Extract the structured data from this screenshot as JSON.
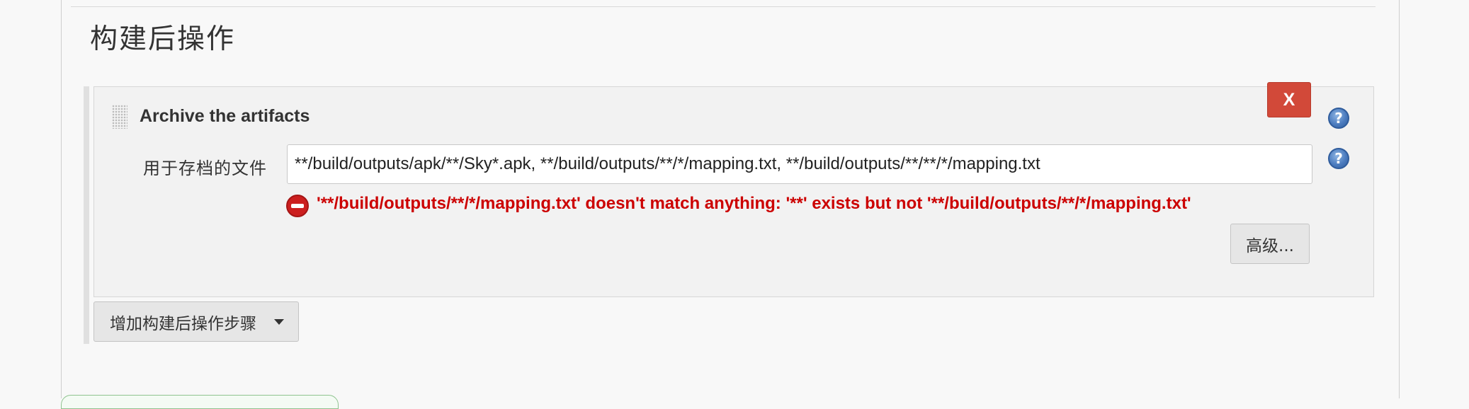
{
  "section": {
    "title": "构建后操作"
  },
  "step": {
    "title": "Archive the artifacts",
    "delete_label": "X",
    "help_glyph": "?",
    "field_label": "用于存档的文件",
    "field_value": "**/build/outputs/apk/**/Sky*.apk, **/build/outputs/**/*/mapping.txt, **/build/outputs/**/**/*/mapping.txt",
    "error_message": "'**/build/outputs/**/*/mapping.txt' doesn't match anything: '**' exists but not '**/build/outputs/**/*/mapping.txt'",
    "advanced_label": "高级..."
  },
  "add_step": {
    "label": "增加构建后操作步骤"
  },
  "colors": {
    "delete_button": "#d24939",
    "error_text": "#cc0000",
    "help_icon": "#4c7cbf"
  },
  "icons": {
    "drag": "drag-handle-icon",
    "help": "help-icon",
    "error": "error-icon",
    "dropdown": "caret-down-icon"
  }
}
